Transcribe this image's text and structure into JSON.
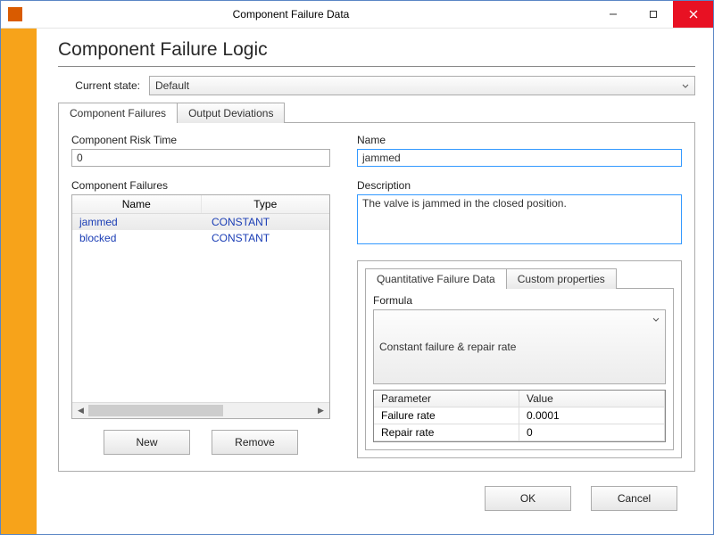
{
  "window": {
    "title": "Component Failure Data",
    "heading": "Component Failure Logic",
    "current_state_label": "Current state:",
    "current_state_value": "Default"
  },
  "tabs": {
    "component_failures": "Component Failures",
    "output_deviations": "Output Deviations"
  },
  "left": {
    "risk_time_label": "Component Risk Time",
    "risk_time_value": "0",
    "failures_label": "Component Failures",
    "col_name": "Name",
    "col_type": "Type",
    "rows": [
      {
        "name": "jammed",
        "type": "CONSTANT"
      },
      {
        "name": "blocked",
        "type": "CONSTANT"
      }
    ],
    "btn_new": "New",
    "btn_remove": "Remove"
  },
  "right": {
    "name_label": "Name",
    "name_value": "jammed",
    "description_label": "Description",
    "description_value": "The valve is jammed in the closed position.",
    "inner_tabs": {
      "quant": "Quantitative Failure Data",
      "custom": "Custom properties"
    },
    "formula_label": "Formula",
    "formula_value": "Constant failure & repair rate",
    "param_header": "Parameter",
    "value_header": "Value",
    "params": [
      {
        "name": "Failure rate",
        "value": "0.0001"
      },
      {
        "name": "Repair rate",
        "value": "0"
      }
    ]
  },
  "dialog": {
    "ok": "OK",
    "cancel": "Cancel"
  }
}
